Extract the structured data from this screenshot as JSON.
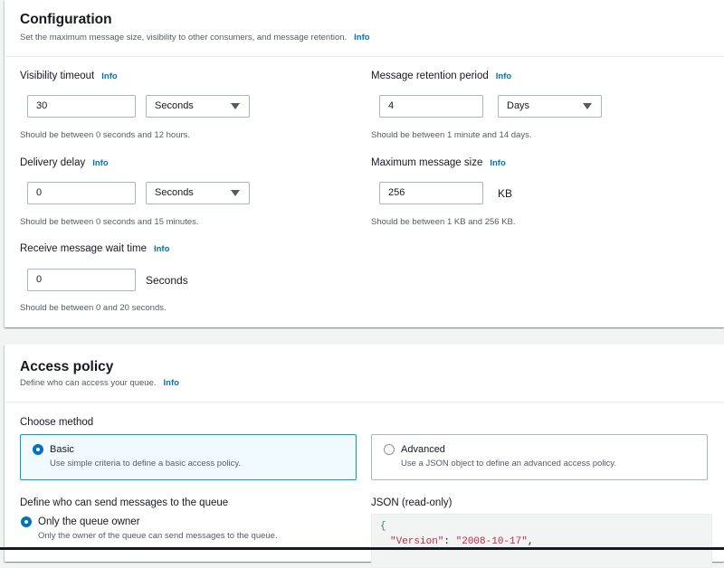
{
  "configuration": {
    "title": "Configuration",
    "description": "Set the maximum message size, visibility to other consumers, and message retention.",
    "info": "Info",
    "visibility_timeout": {
      "label": "Visibility timeout",
      "info": "Info",
      "value": "30",
      "unit": "Seconds",
      "hint": "Should be between 0 seconds and 12 hours."
    },
    "message_retention": {
      "label": "Message retention period",
      "info": "Info",
      "value": "4",
      "unit": "Days",
      "hint": "Should be between 1 minute and 14 days."
    },
    "delivery_delay": {
      "label": "Delivery delay",
      "info": "Info",
      "value": "0",
      "unit": "Seconds",
      "hint": "Should be between 0 seconds and 15 minutes."
    },
    "max_message_size": {
      "label": "Maximum message size",
      "info": "Info",
      "value": "256",
      "unit": "KB",
      "hint": "Should be between 1 KB and 256 KB."
    },
    "receive_wait_time": {
      "label": "Receive message wait time",
      "info": "Info",
      "value": "0",
      "unit": "Seconds",
      "hint": "Should be between 0 and 20 seconds."
    }
  },
  "access_policy": {
    "title": "Access policy",
    "description": "Define who can access your queue.",
    "info": "Info",
    "choose_method_label": "Choose method",
    "basic": {
      "title": "Basic",
      "description": "Use simple criteria to define a basic access policy.",
      "selected": true
    },
    "advanced": {
      "title": "Advanced",
      "description": "Use a JSON object to define an advanced access policy.",
      "selected": false
    },
    "senders_label": "Define who can send messages to the queue",
    "owner_option": {
      "title": "Only the queue owner",
      "description": "Only the owner of the queue can send messages to the queue.",
      "selected": true
    },
    "json_label": "JSON (read-only)",
    "json_lines": {
      "brace": "{",
      "version_key": "\"Version\"",
      "colon": ": ",
      "version_value": "\"2008-10-17\"",
      "comma": ","
    }
  },
  "colors": {
    "link": "#0073bb",
    "selected_tile_border": "#00a1c9",
    "json_brace": "#2e8b57",
    "json_key": "#c7254e",
    "json_string": "#c7254e"
  }
}
